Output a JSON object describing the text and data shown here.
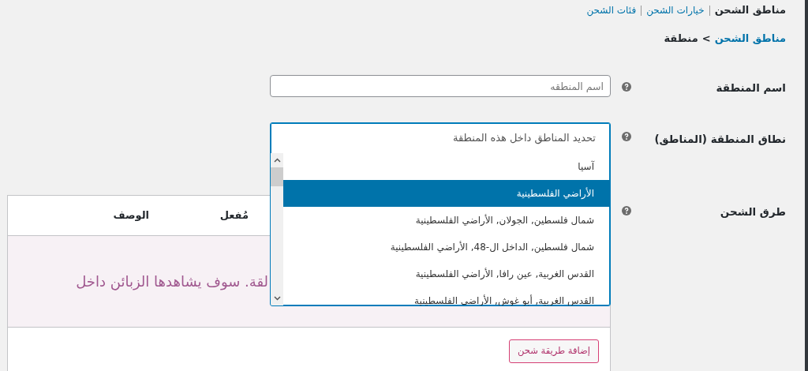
{
  "nav": {
    "items": [
      {
        "label": "مناطق الشحن",
        "selected": true
      },
      {
        "label": "خيارات الشحن",
        "selected": false
      },
      {
        "label": "فئات الشحن",
        "selected": false
      }
    ]
  },
  "breadcrumb": {
    "link": "مناطق الشحن",
    "separator": ">",
    "current": "منطقة"
  },
  "fields": [
    {
      "label": "اسم المنطقة",
      "kind": "text",
      "placeholder": "اسم المنطقه"
    },
    {
      "label": "نطاق المنطقة (المناطق)",
      "kind": "multiselect",
      "placeholder": "تحديد المناطق داخل هذه المنطقة",
      "expanded": true,
      "options": [
        {
          "label": "آسيا",
          "selected": false
        },
        {
          "label": "الأراضي الفلسطينية",
          "selected": true
        },
        {
          "label": "شمال فلسطين, الجولان, الأراضي الفلسطينية",
          "selected": false
        },
        {
          "label": "شمال فلسطين, الداخل ال-48, الأراضي الفلسطينية",
          "selected": false
        },
        {
          "label": "القدس الغربية, عين رافا, الأراضي الفلسطينية",
          "selected": false
        },
        {
          "label": "القدس الغربية, أبو غوش, الأراضي الفلسطينية",
          "selected": false
        }
      ]
    }
  ],
  "shipping_methods": {
    "label": "طرق الشحن",
    "columns": [
      "مُفعل",
      "الوصف"
    ],
    "empty_message": "لقة. سوف يشاهدها الزبائن داخل",
    "button": "إضافة طريقة شحن"
  }
}
